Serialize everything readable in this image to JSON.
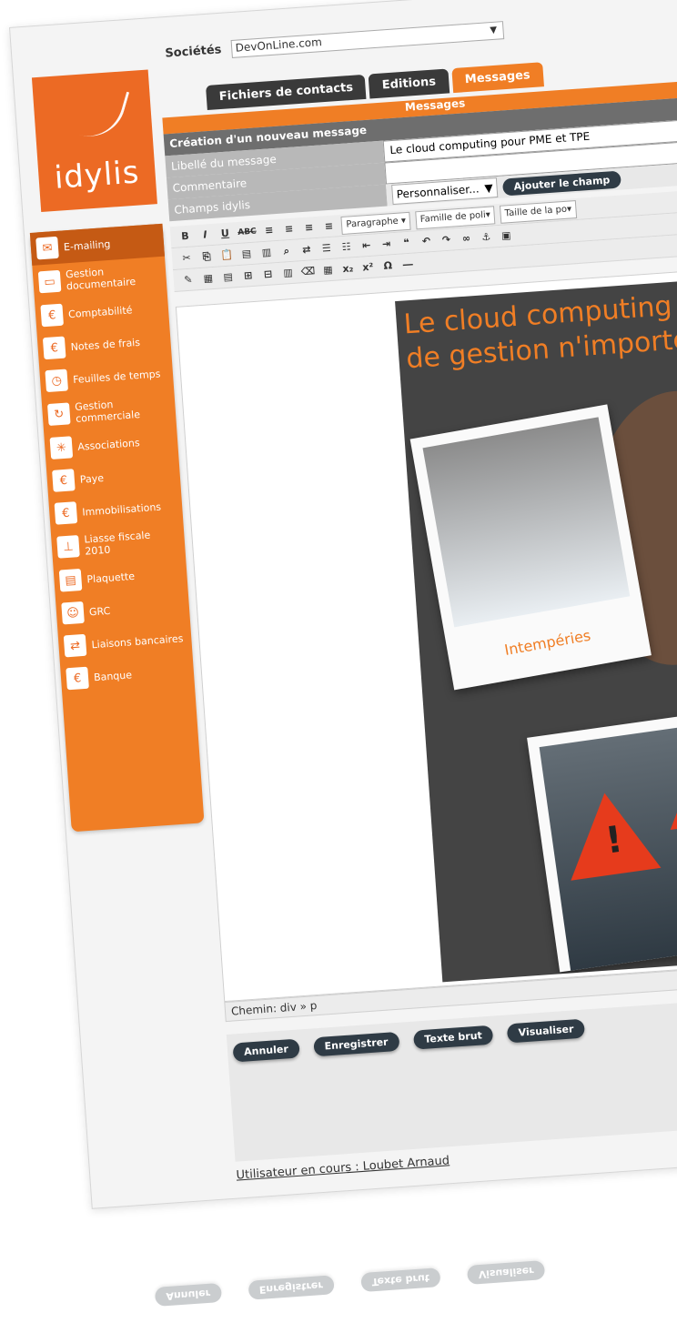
{
  "header": {
    "company_label": "Sociétés",
    "company_value": "DevOnLine.com"
  },
  "logo": {
    "text": "idylis"
  },
  "sidebar": {
    "items": [
      {
        "label": "E-mailing",
        "icon": "envelope-icon",
        "active": true
      },
      {
        "label": "Gestion documentaire",
        "icon": "folder-icon"
      },
      {
        "label": "Comptabilité",
        "icon": "euro-icon"
      },
      {
        "label": "Notes de frais",
        "icon": "receipt-icon"
      },
      {
        "label": "Feuilles de temps",
        "icon": "clock-sheet-icon"
      },
      {
        "label": "Gestion commerciale",
        "icon": "cycle-icon"
      },
      {
        "label": "Associations",
        "icon": "associations-icon"
      },
      {
        "label": "Paye",
        "icon": "pay-icon"
      },
      {
        "label": "Immobilisations",
        "icon": "assets-icon"
      },
      {
        "label": "Liasse fiscale 2010",
        "icon": "org-chart-icon"
      },
      {
        "label": "Plaquette",
        "icon": "brochure-icon"
      },
      {
        "label": "GRC",
        "icon": "users-icon"
      },
      {
        "label": "Liaisons bancaires",
        "icon": "bank-link-icon"
      },
      {
        "label": "Banque",
        "icon": "money-bag-icon"
      }
    ]
  },
  "tabs": [
    {
      "label": "Fichiers de contacts",
      "active": false
    },
    {
      "label": "Editions",
      "active": false
    },
    {
      "label": "Messages",
      "active": true
    }
  ],
  "section_title": "Messages",
  "form": {
    "heading": "Création d'un nouveau message",
    "libelle_label": "Libellé du message",
    "libelle_value": "Le cloud computing pour PME et TPE",
    "commentaire_label": "Commentaire",
    "commentaire_value": "",
    "champs_label": "Champs idylis",
    "champs_select": "Personnaliser...",
    "add_field_button": "Ajouter le champ"
  },
  "editor": {
    "format_select": "Paragraphe",
    "font_family_select": "Famille de poli",
    "font_size_select": "Taille de la po",
    "content_title": "Le cloud computing p de gestion n'importe o",
    "photo_caption": "Intempéries",
    "path_label": "Chemin: div » p"
  },
  "actions": {
    "cancel": "Annuler",
    "save": "Enregistrer",
    "raw": "Texte brut",
    "preview": "Visualiser"
  },
  "footer": {
    "current_user": "Utilisateur en cours : Loubet Arnaud"
  },
  "colors": {
    "accent": "#f07e25",
    "dark_tab": "#3a3a3a",
    "button": "#2f3b45"
  }
}
